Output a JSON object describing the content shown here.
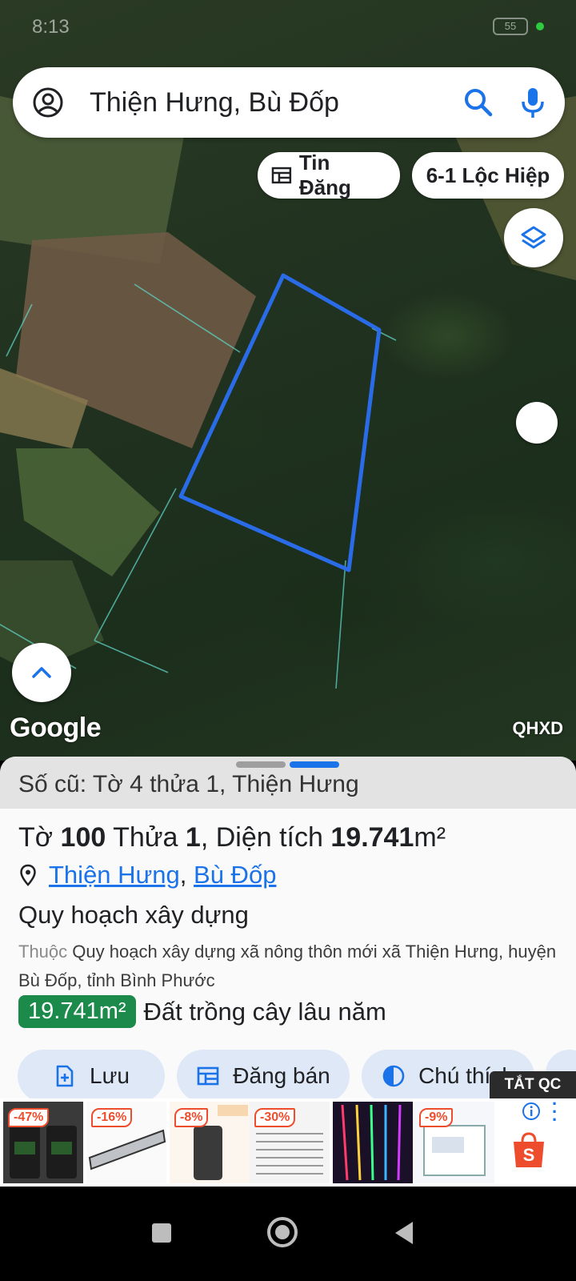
{
  "status": {
    "time": "8:13",
    "battery": "55"
  },
  "search": {
    "query": "Thiện Hưng, Bù Đốp"
  },
  "chips": {
    "listing": "Tin Đăng",
    "location": "6-1 Lộc Hiệp"
  },
  "map": {
    "attribution": "Google",
    "layer_label": "QHXD"
  },
  "sheet": {
    "old_number": "Số cũ: Tờ 4 thửa 1, Thiện Hưng",
    "title": {
      "sheet_prefix": "Tờ",
      "sheet_no": "100",
      "plot_prefix": "Thửa",
      "plot_no": "1",
      "area_prefix": ", Diện tích",
      "area": "19.741",
      "area_unit": "m²"
    },
    "location": {
      "commune": "Thiện Hưng",
      "separator": ",",
      "district": "Bù Đốp"
    },
    "plan_title": "Quy hoạch xây dựng",
    "plan_desc_prefix": "Thuộc",
    "plan_desc": "Quy hoạch xây dựng xã nông thôn mới xã Thiện Hưng, huyện Bù Đốp, tỉnh Bình Phước",
    "area_badge": "19.741m²",
    "land_type": "Đất trồng cây lâu năm",
    "actions": {
      "save": "Lưu",
      "post": "Đăng bán",
      "legend": "Chú thích"
    }
  },
  "ads": {
    "close_label": "TẮT QC",
    "discounts": [
      "-47%",
      "-16%",
      "-8%",
      "-30%",
      "-9%"
    ],
    "shop_letter": "S"
  },
  "colors": {
    "accent": "#1a73e8",
    "parcel_outline": "#2a6ce8",
    "area_badge": "#1b8a4b",
    "shopee": "#ee4d2d"
  }
}
